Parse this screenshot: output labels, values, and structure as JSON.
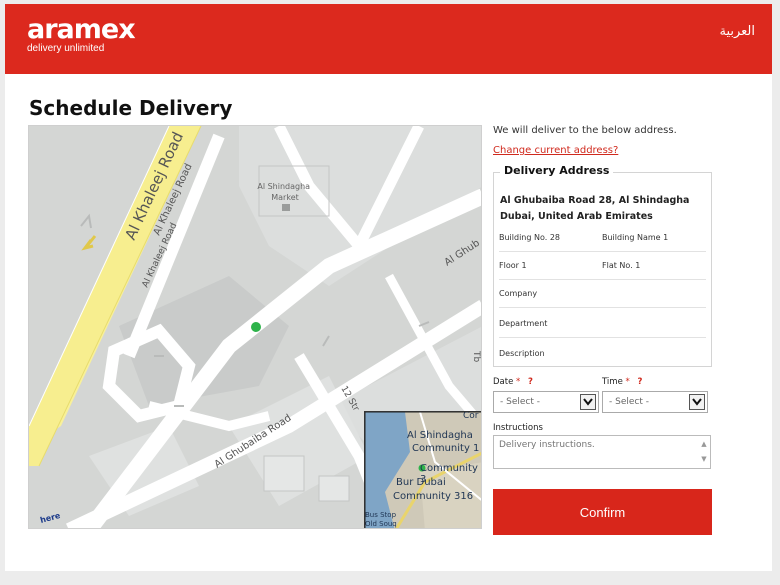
{
  "header": {
    "logo_word": "aramex",
    "logo_tagline": "delivery unlimited",
    "language_link": "العربية",
    "brand_color": "#dc291e"
  },
  "page_title": "Schedule Delivery",
  "map": {
    "labels": {
      "al_khaleej_road_1": "Al Khaleej Road",
      "al_khaleej_road_2": "Al Khaleej Road",
      "al_khaleej_road_3": "Al Khaleej Road",
      "market": "Al Shindagha\nMarket",
      "al_ghubaiba_road": "Al Ghubaiba Road",
      "al_ghubaiba_right": "Al Ghub",
      "street_12": "12 Str",
      "tb": "Tb",
      "here_logo": "here"
    },
    "inset_labels": {
      "al_shindagha": "Al Shindagha",
      "community_1": "Community 1",
      "community_3": "Community 3",
      "bur_dubai": "Bur Dubai",
      "community_316": "Community 316",
      "bus_stop": "Bus Stop",
      "old_souq": "Old Souq",
      "cor": "Cor"
    }
  },
  "delivery_info": {
    "note": "We will deliver to the below address.",
    "change_link": "Change current address?"
  },
  "address": {
    "legend": "Delivery Address",
    "line1": "Al Ghubaiba Road 28, Al Shindagha",
    "line2": "Dubai, United Arab Emirates",
    "building_no": "Building No. 28",
    "building_name": "Building Name 1",
    "floor": "Floor 1",
    "flat": "Flat No. 1",
    "company": "Company",
    "department": "Department",
    "description": "Description"
  },
  "form": {
    "date_label": "Date",
    "time_label": "Time",
    "required_mark": "*",
    "help_mark": "?",
    "date_value": "- Select -",
    "time_value": "- Select -",
    "instructions_label": "Instructions",
    "instructions_placeholder": "Delivery instructions.",
    "confirm_label": "Confirm"
  }
}
